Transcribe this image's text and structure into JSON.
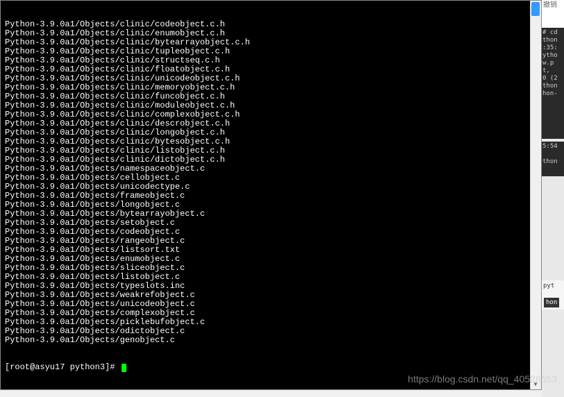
{
  "terminal": {
    "lines": [
      "Python-3.9.0a1/Objects/clinic/codeobject.c.h",
      "Python-3.9.0a1/Objects/clinic/enumobject.c.h",
      "Python-3.9.0a1/Objects/clinic/bytearrayobject.c.h",
      "Python-3.9.0a1/Objects/clinic/tupleobject.c.h",
      "Python-3.9.0a1/Objects/clinic/structseq.c.h",
      "Python-3.9.0a1/Objects/clinic/floatobject.c.h",
      "Python-3.9.0a1/Objects/clinic/unicodeobject.c.h",
      "Python-3.9.0a1/Objects/clinic/memoryobject.c.h",
      "Python-3.9.0a1/Objects/clinic/funcobject.c.h",
      "Python-3.9.0a1/Objects/clinic/moduleobject.c.h",
      "Python-3.9.0a1/Objects/clinic/complexobject.c.h",
      "Python-3.9.0a1/Objects/clinic/descrobject.c.h",
      "Python-3.9.0a1/Objects/clinic/longobject.c.h",
      "Python-3.9.0a1/Objects/clinic/bytesobject.c.h",
      "Python-3.9.0a1/Objects/clinic/listobject.c.h",
      "Python-3.9.0a1/Objects/clinic/dictobject.c.h",
      "Python-3.9.0a1/Objects/namespaceobject.c",
      "Python-3.9.0a1/Objects/cellobject.c",
      "Python-3.9.0a1/Objects/unicodectype.c",
      "Python-3.9.0a1/Objects/frameobject.c",
      "Python-3.9.0a1/Objects/longobject.c",
      "Python-3.9.0a1/Objects/bytearrayobject.c",
      "Python-3.9.0a1/Objects/setobject.c",
      "Python-3.9.0a1/Objects/codeobject.c",
      "Python-3.9.0a1/Objects/rangeobject.c",
      "Python-3.9.0a1/Objects/listsort.txt",
      "Python-3.9.0a1/Objects/enumobject.c",
      "Python-3.9.0a1/Objects/sliceobject.c",
      "Python-3.9.0a1/Objects/listobject.c",
      "Python-3.9.0a1/Objects/typeslots.inc",
      "Python-3.9.0a1/Objects/weakrefobject.c",
      "Python-3.9.0a1/Objects/unicodeobject.c",
      "Python-3.9.0a1/Objects/complexobject.c",
      "Python-3.9.0a1/Objects/picklebufobject.c",
      "Python-3.9.0a1/Objects/odictobject.c",
      "Python-3.9.0a1/Objects/genobject.c"
    ],
    "prompt": "[root@asyu17 python3]# "
  },
  "background": {
    "top_text": "撤销",
    "dark_lines": [
      "# cd",
      "thon",
      ":35:",
      "ytho",
      "w.p",
      "t,",
      "0 (2",
      "thon",
      "hon-"
    ],
    "mid_text": "5:54",
    "bottom_text": "thon",
    "tag1": "pyt",
    "tag2": "hon"
  },
  "watermark": "https://blog.csdn.net/qq_40528553"
}
